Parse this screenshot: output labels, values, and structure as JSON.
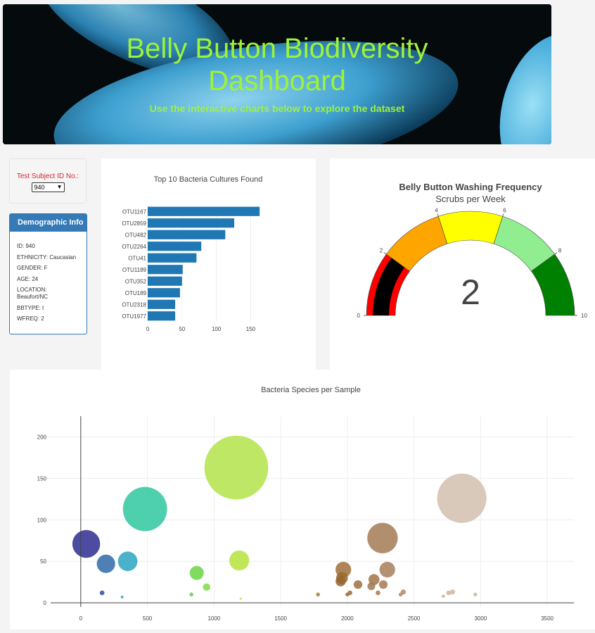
{
  "header": {
    "title_line1": "Belly Button Biodiversity",
    "title_line2": "Dashboard",
    "subtitle": "Use the interactive charts below to explore the dataset"
  },
  "selector": {
    "label": "Test Subject ID No.:",
    "selected": "940"
  },
  "demographics": {
    "title": "Demographic Info",
    "rows": [
      "ID: 940",
      "ETHNICITY: Caucasian",
      "GENDER: F",
      "AGE: 24",
      "LOCATION: Beaufort/NC",
      "BBTYPE: I",
      "WFREQ: 2"
    ]
  },
  "colors": {
    "accent": "#9ff23a",
    "bar": "#1f77b4",
    "panel_border": "#337ab7"
  },
  "chart_data": [
    {
      "type": "bar",
      "orientation": "horizontal",
      "title": "Top 10 Bacteria Cultures Found",
      "categories": [
        "OTU1167",
        "OTU2859",
        "OTU482",
        "OTU2264",
        "OTU41",
        "OTU1189",
        "OTU352",
        "OTU189",
        "OTU2318",
        "OTU1977"
      ],
      "values": [
        163,
        126,
        113,
        78,
        71,
        51,
        50,
        47,
        40,
        40
      ],
      "xlim": [
        0,
        170
      ],
      "xticks": [
        0,
        50,
        100,
        150
      ]
    },
    {
      "type": "gauge",
      "title": "Belly Button Washing Frequency",
      "subtitle": "Scrubs per Week",
      "value": 2,
      "range": [
        0,
        10
      ],
      "ticks": [
        0,
        2,
        4,
        6,
        8,
        10
      ],
      "steps": [
        {
          "range": [
            0,
            2
          ],
          "color": "#ff0000"
        },
        {
          "range": [
            2,
            4
          ],
          "color": "#ffa500"
        },
        {
          "range": [
            4,
            6
          ],
          "color": "#ffff00"
        },
        {
          "range": [
            6,
            8
          ],
          "color": "#90ee90"
        },
        {
          "range": [
            8,
            10
          ],
          "color": "#008000"
        }
      ],
      "bar_color": "#000000"
    },
    {
      "type": "scatter",
      "title": "Bacteria Species per Sample",
      "xlim": [
        -300,
        3700
      ],
      "ylim": [
        -5,
        225
      ],
      "xticks": [
        0,
        500,
        1000,
        1500,
        2000,
        2500,
        3000,
        3500
      ],
      "yticks": [
        0,
        50,
        100,
        150,
        200
      ],
      "grid": true,
      "points": [
        {
          "x": 41,
          "y": 71,
          "color": "#2e2d8f"
        },
        {
          "x": 189,
          "y": 47,
          "color": "#2f6aa8"
        },
        {
          "x": 352,
          "y": 50,
          "color": "#2aa6bf"
        },
        {
          "x": 482,
          "y": 113,
          "color": "#2fc7a0"
        },
        {
          "x": 1167,
          "y": 163,
          "color": "#b3e34a"
        },
        {
          "x": 1189,
          "y": 51,
          "color": "#b5e33d"
        },
        {
          "x": 870,
          "y": 36,
          "color": "#6bd544"
        },
        {
          "x": 944,
          "y": 19,
          "color": "#7fd94a"
        },
        {
          "x": 160,
          "y": 12,
          "color": "#2b4ea2"
        },
        {
          "x": 310,
          "y": 7,
          "color": "#2a9cc5"
        },
        {
          "x": 830,
          "y": 10,
          "color": "#5fd04c"
        },
        {
          "x": 1200,
          "y": 5,
          "color": "#c9e23a"
        },
        {
          "x": 1970,
          "y": 40,
          "color": "#a0703a"
        },
        {
          "x": 1960,
          "y": 30,
          "color": "#9a6a2e"
        },
        {
          "x": 1950,
          "y": 26,
          "color": "#94642a"
        },
        {
          "x": 2080,
          "y": 22,
          "color": "#9c6e40"
        },
        {
          "x": 2200,
          "y": 28,
          "color": "#a07448"
        },
        {
          "x": 2180,
          "y": 20,
          "color": "#a27850"
        },
        {
          "x": 2264,
          "y": 78,
          "color": "#a37a55"
        },
        {
          "x": 2300,
          "y": 40,
          "color": "#a87e5c"
        },
        {
          "x": 2270,
          "y": 22,
          "color": "#a67a55"
        },
        {
          "x": 2230,
          "y": 12,
          "color": "#a6784e"
        },
        {
          "x": 2020,
          "y": 12,
          "color": "#9a6a3a"
        },
        {
          "x": 2000,
          "y": 10,
          "color": "#9a6c3c"
        },
        {
          "x": 1780,
          "y": 10,
          "color": "#a87a3a"
        },
        {
          "x": 2420,
          "y": 13,
          "color": "#b08a6a"
        },
        {
          "x": 2400,
          "y": 10,
          "color": "#b08866"
        },
        {
          "x": 2859,
          "y": 126,
          "color": "#d2bfae"
        },
        {
          "x": 2790,
          "y": 13,
          "color": "#d0b49c"
        },
        {
          "x": 2760,
          "y": 12,
          "color": "#ceb39c"
        },
        {
          "x": 2960,
          "y": 10,
          "color": "#cbb8a6"
        },
        {
          "x": 2720,
          "y": 8,
          "color": "#c8a888"
        }
      ]
    }
  ]
}
